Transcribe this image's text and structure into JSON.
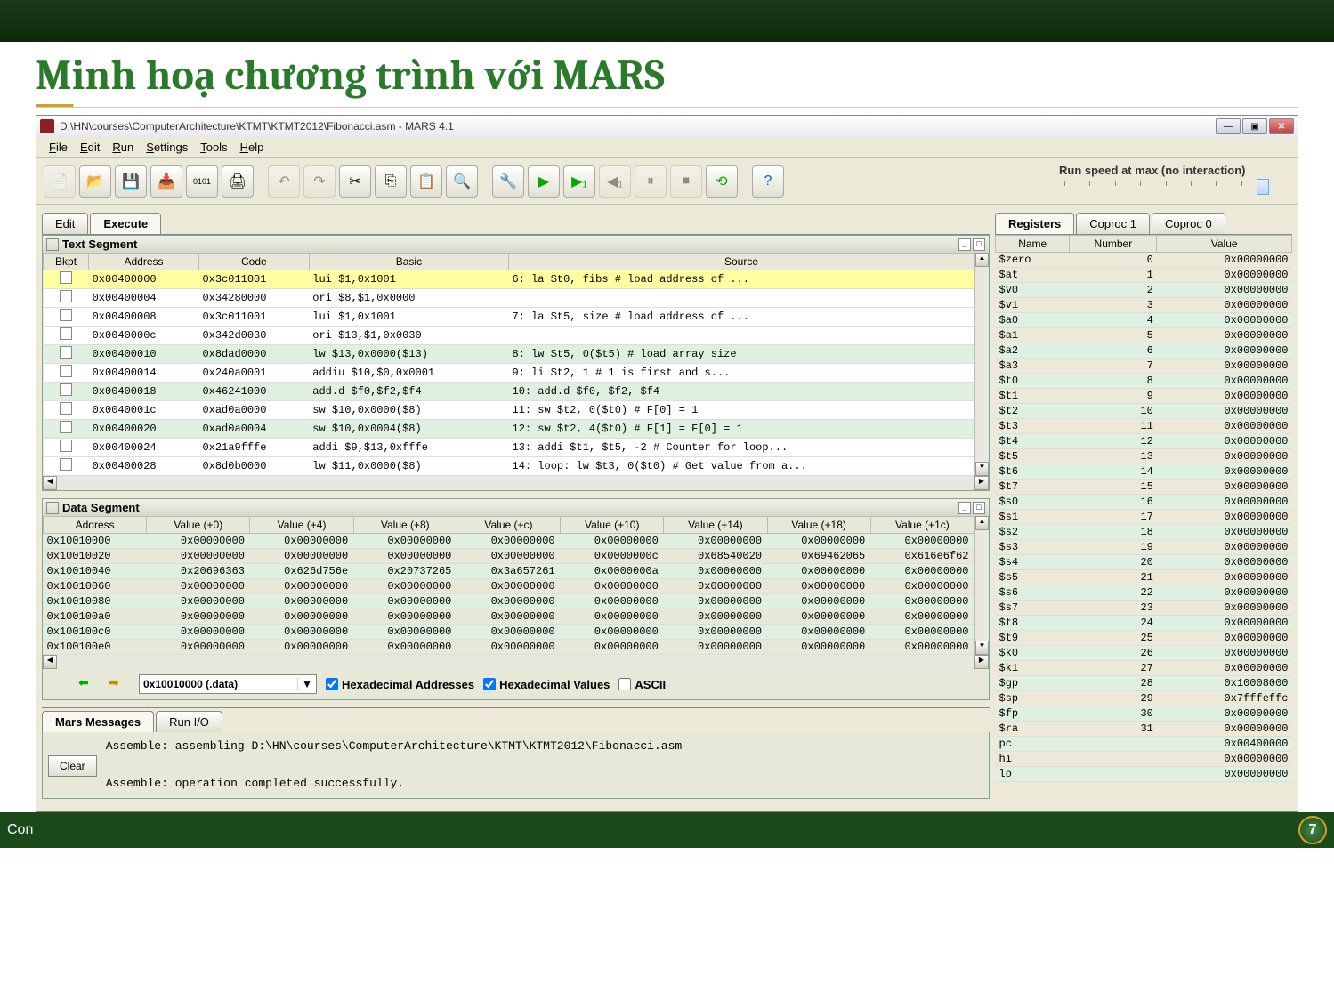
{
  "slide_title": "Minh hoạ chương trình với MARS",
  "title_bar": "D:\\HN\\courses\\ComputerArchitecture\\KTMT\\KTMT2012\\Fibonacci.asm  - MARS 4.1",
  "menus": [
    "File",
    "Edit",
    "Run",
    "Settings",
    "Tools",
    "Help"
  ],
  "run_speed_label": "Run speed at max (no interaction)",
  "tabs_main": {
    "edit": "Edit",
    "execute": "Execute"
  },
  "text_segment": {
    "title": "Text Segment",
    "headers": [
      "Bkpt",
      "Address",
      "Code",
      "Basic",
      "Source"
    ],
    "rows": [
      {
        "addr": "0x00400000",
        "code": "0x3c011001",
        "basic": "lui $1,0x1001",
        "src": "  6:        la   $t0, fibs        # load address of ...",
        "hl": true
      },
      {
        "addr": "0x00400004",
        "code": "0x34280000",
        "basic": "ori $8,$1,0x0000",
        "src": ""
      },
      {
        "addr": "0x00400008",
        "code": "0x3c011001",
        "basic": "lui $1,0x1001",
        "src": "  7:        la   $t5, size        # load address of ..."
      },
      {
        "addr": "0x0040000c",
        "code": "0x342d0030",
        "basic": "ori $13,$1,0x0030",
        "src": ""
      },
      {
        "addr": "0x00400010",
        "code": "0x8dad0000",
        "basic": "lw $13,0x0000($13)",
        "src": "  8:        lw   $t5, 0($t5)      # load array size",
        "alt": true
      },
      {
        "addr": "0x00400014",
        "code": "0x240a0001",
        "basic": "addiu $10,$0,0x0001",
        "src": "  9:        li   $t2, 1           # 1 is first and s..."
      },
      {
        "addr": "0x00400018",
        "code": "0x46241000",
        "basic": "add.d $f0,$f2,$f4",
        "src": " 10:        add.d $f0, $f2, $f4",
        "alt": true
      },
      {
        "addr": "0x0040001c",
        "code": "0xad0a0000",
        "basic": "sw $10,0x0000($8)",
        "src": " 11:        sw   $t2, 0($t0)      # F[0] = 1"
      },
      {
        "addr": "0x00400020",
        "code": "0xad0a0004",
        "basic": "sw $10,0x0004($8)",
        "src": " 12:        sw   $t2, 4($t0)      # F[1] = F[0] = 1",
        "alt": true
      },
      {
        "addr": "0x00400024",
        "code": "0x21a9fffe",
        "basic": "addi $9,$13,0xfffe",
        "src": " 13:        addi $t1, $t5, -2     # Counter for loop..."
      },
      {
        "addr": "0x00400028",
        "code": "0x8d0b0000",
        "basic": "lw $11,0x0000($8)",
        "src": " 14: loop:  lw   $t3, 0($t0)      # Get value from a..."
      }
    ]
  },
  "data_segment": {
    "title": "Data Segment",
    "headers": [
      "Address",
      "Value (+0)",
      "Value (+4)",
      "Value (+8)",
      "Value (+c)",
      "Value (+10)",
      "Value (+14)",
      "Value (+18)",
      "Value (+1c)"
    ],
    "rows": [
      {
        "addr": "0x10010000",
        "v": [
          "0x00000000",
          "0x00000000",
          "0x00000000",
          "0x00000000",
          "0x00000000",
          "0x00000000",
          "0x00000000",
          "0x00000000"
        ],
        "alt": true
      },
      {
        "addr": "0x10010020",
        "v": [
          "0x00000000",
          "0x00000000",
          "0x00000000",
          "0x00000000",
          "0x0000000c",
          "0x68540020",
          "0x69462065",
          "0x616e6f62"
        ]
      },
      {
        "addr": "0x10010040",
        "v": [
          "0x20696363",
          "0x626d756e",
          "0x20737265",
          "0x3a657261",
          "0x0000000a",
          "0x00000000",
          "0x00000000",
          "0x00000000"
        ],
        "alt": true
      },
      {
        "addr": "0x10010060",
        "v": [
          "0x00000000",
          "0x00000000",
          "0x00000000",
          "0x00000000",
          "0x00000000",
          "0x00000000",
          "0x00000000",
          "0x00000000"
        ]
      },
      {
        "addr": "0x10010080",
        "v": [
          "0x00000000",
          "0x00000000",
          "0x00000000",
          "0x00000000",
          "0x00000000",
          "0x00000000",
          "0x00000000",
          "0x00000000"
        ],
        "alt": true
      },
      {
        "addr": "0x100100a0",
        "v": [
          "0x00000000",
          "0x00000000",
          "0x00000000",
          "0x00000000",
          "0x00000000",
          "0x00000000",
          "0x00000000",
          "0x00000000"
        ]
      },
      {
        "addr": "0x100100c0",
        "v": [
          "0x00000000",
          "0x00000000",
          "0x00000000",
          "0x00000000",
          "0x00000000",
          "0x00000000",
          "0x00000000",
          "0x00000000"
        ],
        "alt": true
      },
      {
        "addr": "0x100100e0",
        "v": [
          "0x00000000",
          "0x00000000",
          "0x00000000",
          "0x00000000",
          "0x00000000",
          "0x00000000",
          "0x00000000",
          "0x00000000"
        ]
      }
    ],
    "combo": "0x10010000 (.data)",
    "hex_addr": "Hexadecimal Addresses",
    "hex_val": "Hexadecimal Values",
    "ascii": "ASCII"
  },
  "messages": {
    "tabs": {
      "mars": "Mars Messages",
      "runio": "Run I/O"
    },
    "clear": "Clear",
    "lines": [
      "Assemble: assembling D:\\HN\\courses\\ComputerArchitecture\\KTMT\\KTMT2012\\Fibonacci.asm",
      "",
      "Assemble: operation completed successfully."
    ]
  },
  "registers": {
    "tabs": {
      "reg": "Registers",
      "cop1": "Coproc 1",
      "cop0": "Coproc 0"
    },
    "headers": [
      "Name",
      "Number",
      "Value"
    ],
    "rows": [
      {
        "n": "$zero",
        "num": "0",
        "v": "0x00000000"
      },
      {
        "n": "$at",
        "num": "1",
        "v": "0x00000000"
      },
      {
        "n": "$v0",
        "num": "2",
        "v": "0x00000000",
        "alt": true
      },
      {
        "n": "$v1",
        "num": "3",
        "v": "0x00000000"
      },
      {
        "n": "$a0",
        "num": "4",
        "v": "0x00000000",
        "alt": true
      },
      {
        "n": "$a1",
        "num": "5",
        "v": "0x00000000"
      },
      {
        "n": "$a2",
        "num": "6",
        "v": "0x00000000",
        "alt": true
      },
      {
        "n": "$a3",
        "num": "7",
        "v": "0x00000000"
      },
      {
        "n": "$t0",
        "num": "8",
        "v": "0x00000000",
        "alt": true
      },
      {
        "n": "$t1",
        "num": "9",
        "v": "0x00000000"
      },
      {
        "n": "$t2",
        "num": "10",
        "v": "0x00000000",
        "alt": true
      },
      {
        "n": "$t3",
        "num": "11",
        "v": "0x00000000"
      },
      {
        "n": "$t4",
        "num": "12",
        "v": "0x00000000",
        "alt": true
      },
      {
        "n": "$t5",
        "num": "13",
        "v": "0x00000000"
      },
      {
        "n": "$t6",
        "num": "14",
        "v": "0x00000000",
        "alt": true
      },
      {
        "n": "$t7",
        "num": "15",
        "v": "0x00000000"
      },
      {
        "n": "$s0",
        "num": "16",
        "v": "0x00000000",
        "alt": true
      },
      {
        "n": "$s1",
        "num": "17",
        "v": "0x00000000"
      },
      {
        "n": "$s2",
        "num": "18",
        "v": "0x00000000",
        "alt": true
      },
      {
        "n": "$s3",
        "num": "19",
        "v": "0x00000000"
      },
      {
        "n": "$s4",
        "num": "20",
        "v": "0x00000000",
        "alt": true
      },
      {
        "n": "$s5",
        "num": "21",
        "v": "0x00000000"
      },
      {
        "n": "$s6",
        "num": "22",
        "v": "0x00000000",
        "alt": true
      },
      {
        "n": "$s7",
        "num": "23",
        "v": "0x00000000"
      },
      {
        "n": "$t8",
        "num": "24",
        "v": "0x00000000",
        "alt": true
      },
      {
        "n": "$t9",
        "num": "25",
        "v": "0x00000000"
      },
      {
        "n": "$k0",
        "num": "26",
        "v": "0x00000000",
        "alt": true
      },
      {
        "n": "$k1",
        "num": "27",
        "v": "0x00000000"
      },
      {
        "n": "$gp",
        "num": "28",
        "v": "0x10008000",
        "alt": true
      },
      {
        "n": "$sp",
        "num": "29",
        "v": "0x7fffeffc"
      },
      {
        "n": "$fp",
        "num": "30",
        "v": "0x00000000",
        "alt": true
      },
      {
        "n": "$ra",
        "num": "31",
        "v": "0x00000000"
      },
      {
        "n": "pc",
        "num": "",
        "v": "0x00400000",
        "alt": true
      },
      {
        "n": "hi",
        "num": "",
        "v": "0x00000000"
      },
      {
        "n": "lo",
        "num": "",
        "v": "0x00000000",
        "alt": true
      }
    ]
  },
  "footer_left": "Con",
  "page_number": "7"
}
